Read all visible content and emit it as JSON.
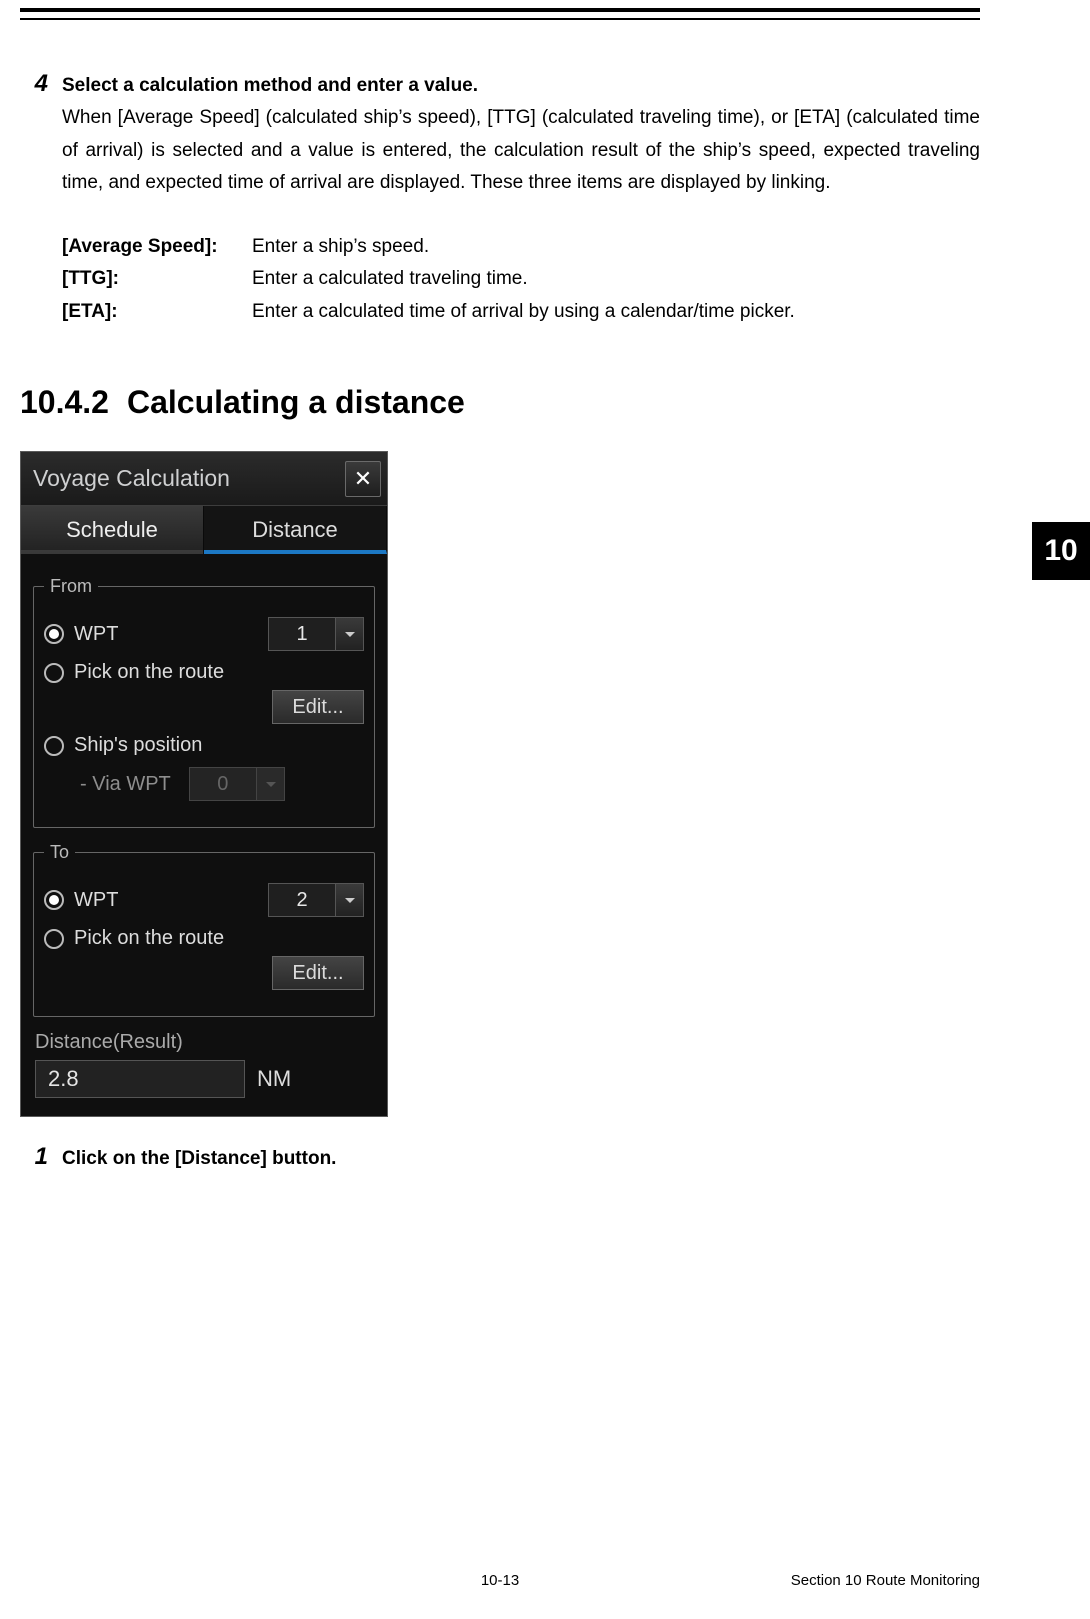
{
  "step4": {
    "num": "4",
    "title": "Select a calculation method and enter a value.",
    "desc": "When [Average Speed] (calculated ship’s speed), [TTG] (calculated traveling time), or [ETA] (calculated time of arrival) is selected and a value is entered, the calculation result of the ship’s speed, expected traveling time, and expected time of arrival are displayed. These three items are displayed by linking."
  },
  "defs": {
    "k1": "[Average Speed]:",
    "v1": "Enter a ship’s speed.",
    "k2": "[TTG]:",
    "v2": "Enter a calculated traveling time.",
    "k3": "[ETA]:",
    "v3": "Enter a calculated time of arrival by using a calendar/time picker."
  },
  "section": {
    "no": "10.4.2",
    "title": "Calculating a distance"
  },
  "sidetab": "10",
  "dialog": {
    "title": "Voyage Calculation",
    "tabs": {
      "schedule": "Schedule",
      "distance": "Distance"
    },
    "from": {
      "legend": "From",
      "wpt_label": "WPT",
      "wpt_value": "1",
      "pick_label": "Pick on the route",
      "edit": "Edit...",
      "ship_pos_label": "Ship's position",
      "via_label": "- Via WPT",
      "via_value": "0"
    },
    "to": {
      "legend": "To",
      "wpt_label": "WPT",
      "wpt_value": "2",
      "pick_label": "Pick on the route",
      "edit": "Edit..."
    },
    "result": {
      "label": "Distance(Result)",
      "value": "2.8",
      "unit": "NM"
    }
  },
  "step1": {
    "num": "1",
    "title": "Click on the [Distance] button."
  },
  "footer": {
    "page": "10-13",
    "section": "Section 10    Route Monitoring"
  }
}
